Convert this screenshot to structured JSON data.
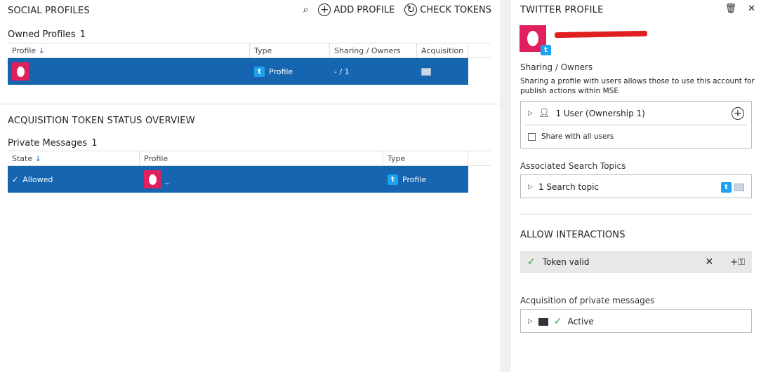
{
  "left": {
    "title": "SOCIAL PROFILES",
    "toolbar": {
      "add_profile": "ADD PROFILE",
      "check_tokens": "CHECK TOKENS"
    },
    "owned": {
      "label": "Owned Profiles",
      "count": "1",
      "columns": [
        "Profile",
        "Type",
        "Sharing / Owners",
        "Acquisition"
      ],
      "row": {
        "name": "",
        "type": "Profile",
        "sharing": "- / 1"
      }
    },
    "acq_title": "ACQUISITION TOKEN STATUS OVERVIEW",
    "private": {
      "label": "Private Messages",
      "count": "1",
      "columns": [
        "State",
        "Profile",
        "Type"
      ],
      "row": {
        "state": "Allowed",
        "profile": "_",
        "type": "Profile"
      }
    }
  },
  "right": {
    "title": "TWITTER PROFILE",
    "sharing_label": "Sharing / Owners",
    "sharing_desc": "Sharing a profile with users allows those to use this account for publish actions within MSE",
    "users": "1 User (Ownership 1)",
    "share_all": "Share with all users",
    "search_label": "Associated Search Topics",
    "search_topic": "1 Search topic",
    "allow_title": "ALLOW INTERACTIONS",
    "token": "Token valid",
    "acq_label": "Acquisition of private messages",
    "acq_status": "Active"
  },
  "colors": {
    "selected_row": "#1565b0",
    "avatar": "#e01f5d",
    "twitter": "#1da1f2",
    "valid": "#2e9e3a"
  }
}
